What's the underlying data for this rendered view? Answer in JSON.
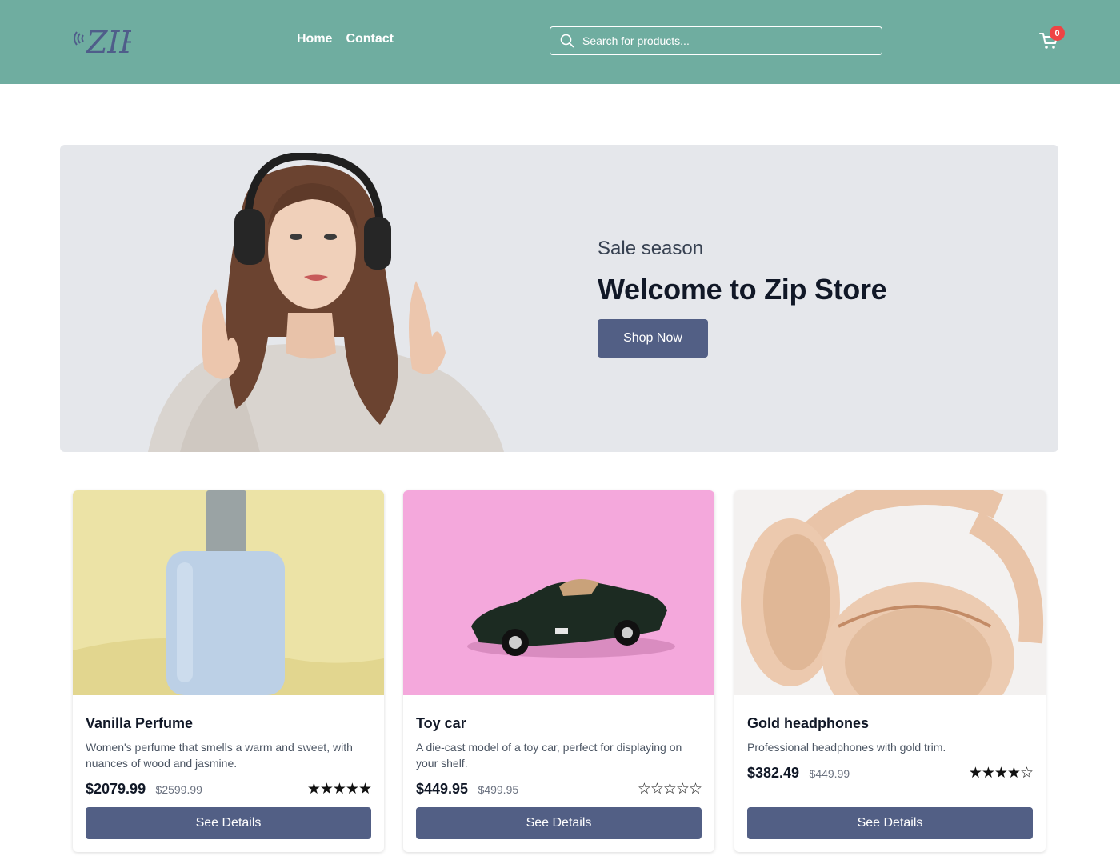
{
  "header": {
    "logo_text": "ZIP",
    "nav": [
      {
        "label": "Home"
      },
      {
        "label": "Contact"
      }
    ],
    "search": {
      "placeholder": "Search for products...",
      "value": ""
    },
    "cart": {
      "count": "0"
    },
    "colors": {
      "background": "#6fada0",
      "badge": "#ef4444"
    }
  },
  "hero": {
    "subtitle": "Sale season",
    "title": "Welcome to Zip Store",
    "cta_label": "Shop Now",
    "colors": {
      "background": "#e5e7eb",
      "button": "#525f85"
    }
  },
  "products": [
    {
      "name": "Vanilla Perfume",
      "description": "Women's perfume that smells a warm and sweet, with nuances of wood and jasmine.",
      "price": "$2079.99",
      "old_price": "$2599.99",
      "rating": 5,
      "stars": "★★★★★",
      "button_label": "See Details",
      "image": "perfume-bottle"
    },
    {
      "name": "Toy car",
      "description": "A die-cast model of a toy car, perfect for displaying on your shelf.",
      "price": "$449.95",
      "old_price": "$499.95",
      "rating": 0,
      "stars": "☆☆☆☆☆",
      "button_label": "See Details",
      "image": "toy-car"
    },
    {
      "name": "Gold headphones",
      "description": "Professional headphones with gold trim.",
      "price": "$382.49",
      "old_price": "$449.99",
      "rating": 4,
      "stars": "★★★★☆",
      "button_label": "See Details",
      "image": "gold-headphones"
    }
  ]
}
